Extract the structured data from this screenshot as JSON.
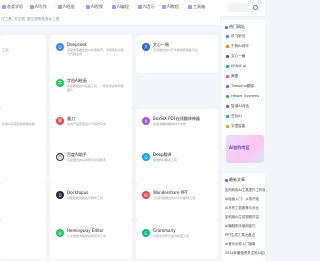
{
  "nav": {
    "items": [
      {
        "label": "各类学机"
      },
      {
        "label": "AI写作"
      },
      {
        "label": "AI绘画"
      },
      {
        "label": "AI视频"
      },
      {
        "label": "AI编程"
      },
      {
        "label": "AI音乐"
      },
      {
        "label": "AI教程"
      },
      {
        "label": "工具箱"
      }
    ]
  },
  "subtitle": "作工具, 文生图, 图生图等各类AI工具",
  "cards": [
    {
      "title": "",
      "desc": "工具。",
      "tags": "",
      "variant": "partial"
    },
    {
      "title": "Deepseek",
      "desc": "深度求索推出的AI对话助手，支持多轮对话与代码生成",
      "logo_color": "#3b82f6",
      "logo_glyph": "D"
    },
    {
      "title": "文心一格",
      "desc": "百度推出的AI艺术和创意辅助平台",
      "logo_color": "#2563eb",
      "logo_glyph": "文"
    },
    {
      "title": "",
      "desc": "",
      "tags": "",
      "variant": "partial"
    },
    {
      "title": "字由AI绘画",
      "desc": "字由推出的AI绘画工具，一键生成多种风格图片",
      "logo_color": "#22c55e",
      "logo_glyph": "字"
    },
    {
      "title": "",
      "desc": "",
      "variant": "empty"
    },
    {
      "title": "",
      "desc": "利用AI实现高效视频剪辑",
      "tags": "",
      "variant": "partial"
    },
    {
      "title": "墨刀",
      "desc": "在线产品原型设计与协作平台",
      "logo_color": "#ef4444",
      "logo_glyph": "墨"
    },
    {
      "title": "BoxSiX PDF在线翻译神器",
      "desc": "快速准确地翻译PDF文档",
      "logo_color": "#a855f7",
      "logo_glyph": "X"
    },
    {
      "title": "",
      "desc": "",
      "tags": "",
      "variant": "partial"
    },
    {
      "title": "百度AI助手",
      "desc": "百度推出的AI搜索与对话助手",
      "logo_color": "#ffffff",
      "logo_glyph": "百"
    },
    {
      "title": "Deep翻译",
      "desc": "精准的AI翻译工具",
      "logo_color": "#0ea5e9",
      "logo_glyph": "D"
    },
    {
      "title": "",
      "desc": "",
      "tags": "",
      "variant": "partial"
    },
    {
      "title": "Docktopus",
      "desc": "AI驱动的文档演示制作工具",
      "logo_color": "#1f2937",
      "logo_glyph": "D"
    },
    {
      "title": "Wondershare PPT",
      "desc": "万兴科技推出的AI PPT制作工具",
      "logo_color": "#ef4444",
      "logo_glyph": "W"
    },
    {
      "title": "",
      "desc": "",
      "tags": "",
      "variant": "partial"
    },
    {
      "title": "Hemingway Editor",
      "desc": "让文章更清晰易读的写作工具",
      "logo_color": "#22c55e",
      "logo_glyph": "H"
    },
    {
      "title": "Grammarly",
      "desc": "AI英文写作与语法检查工具",
      "logo_color": "#10b981",
      "logo_glyph": "G"
    }
  ],
  "sidebar": {
    "hot_title": "热门网址",
    "hot_items": [
      {
        "label": "讯飞听见",
        "color": "#3b82f6"
      },
      {
        "label": "千帆AI创作",
        "color": "#f97316"
      },
      {
        "label": "文心一格",
        "color": "#2563eb"
      },
      {
        "label": "ERNIE AI",
        "color": "#0ea5e9"
      },
      {
        "label": "美图",
        "color": "#ec4899"
      },
      {
        "label": "Tresoline翻译",
        "color": "#8b5cf6"
      },
      {
        "label": "Helper Systems",
        "color": "#22c55e"
      },
      {
        "label": "智谱AI对话",
        "color": "#6366f1"
      },
      {
        "label": "豆包AI",
        "color": "#14b8a6"
      },
      {
        "label": "字语智能",
        "color": "#f59e0b"
      }
    ],
    "promo_text": "AI创作专区",
    "latest_title": "最新文章",
    "articles": [
      {
        "label": "如何利用AI工具提升工作效率"
      },
      {
        "label": "AI绘画入门：从零开始"
      },
      {
        "label": "AI写作工具推荐与对比"
      },
      {
        "label": "如何用AI生成视频内容"
      },
      {
        "label": "AI编程助手使用技巧"
      },
      {
        "label": "PPT生成工具大盘点"
      },
      {
        "label": "AI音乐创作入门指南"
      },
      {
        "label": "2024年最值得关注的AI应用"
      }
    ]
  }
}
